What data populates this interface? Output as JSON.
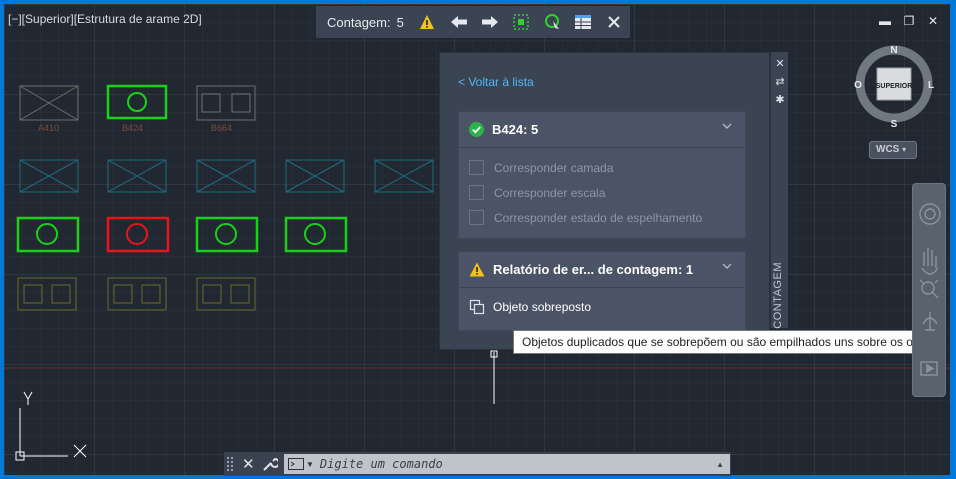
{
  "viewport": {
    "label": "[−][Superior][Estrutura de arame 2D]"
  },
  "count_toolbar": {
    "label": "Contagem:",
    "count": "5",
    "icons": [
      "warning-icon",
      "arrow-left-icon",
      "arrow-right-icon",
      "zoom-selection-icon",
      "insert-block-icon",
      "table-icon",
      "close-icon"
    ]
  },
  "blocks": {
    "names": [
      "A410",
      "B424",
      "B664"
    ]
  },
  "count_panel": {
    "back_link": "< Voltar à lista",
    "block_card": {
      "title": "B424: 5",
      "options": [
        "Corresponder camada",
        "Corresponder escala",
        "Corresponder estado de espelhamento"
      ]
    },
    "report_card": {
      "title": "Relatório de er... de contagem: 1",
      "items": [
        "Objeto sobreposto"
      ]
    },
    "side_label": "CONTAGEM"
  },
  "tooltip": {
    "text": "Objetos duplicados que se sobrepõem ou são empilhados uns sobre os outros"
  },
  "viewcube": {
    "north": "N",
    "south": "S",
    "east": "L",
    "west": "O",
    "face": "SUPERIOR",
    "ucs": "WCS"
  },
  "ucs_icon": {
    "x": "X",
    "y": "Y"
  },
  "command_line": {
    "placeholder": "Digite um comando"
  },
  "colors": {
    "highlight_green": "#19d119",
    "highlight_red": "#e8141a",
    "accent_blue": "#0078d7",
    "link_blue": "#52b6f5",
    "warning_yellow": "#f2c21b"
  }
}
